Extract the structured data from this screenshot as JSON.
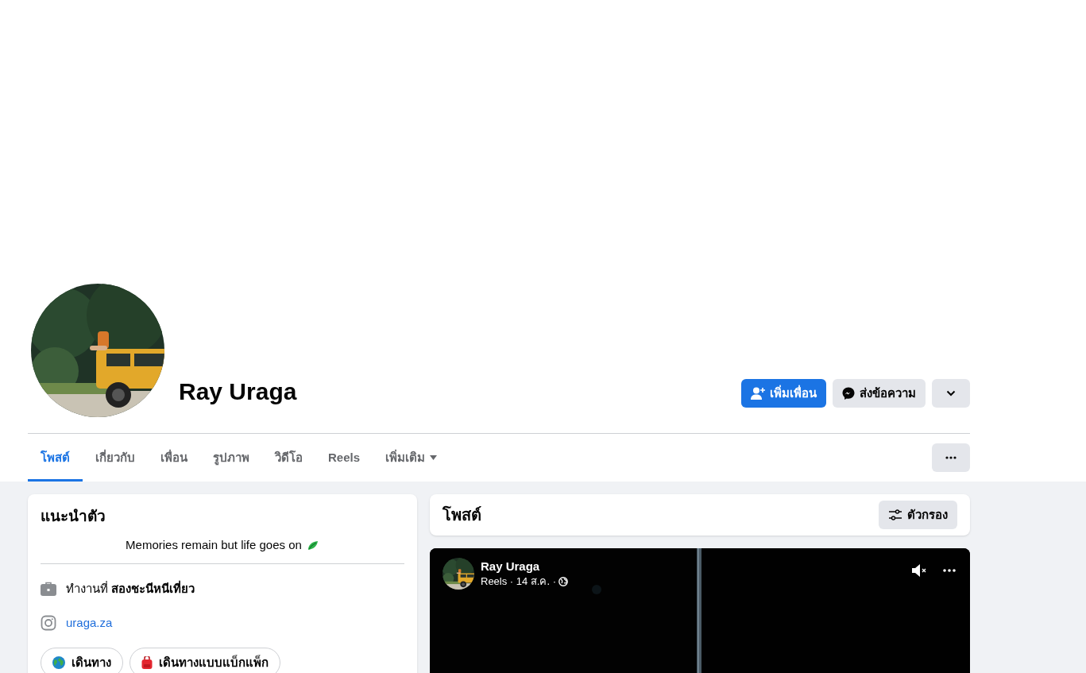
{
  "profile": {
    "name": "Ray Uraga"
  },
  "actions": [
    {
      "label": "เพิ่มเพื่อน",
      "kind": "primary"
    },
    {
      "label": "ส่งข้อความ",
      "kind": "message"
    },
    {
      "kind": "dropdown"
    }
  ],
  "tabs": [
    {
      "label": "โพสต์",
      "selected": true
    },
    {
      "label": "เกี่ยวกับ",
      "selected": false
    },
    {
      "label": "เพื่อน",
      "selected": false
    },
    {
      "label": "รูปภาพ",
      "selected": false
    },
    {
      "label": "วิดีโอ",
      "selected": false
    },
    {
      "label": "Reels",
      "selected": false
    },
    {
      "label": "เพิ่มเติม",
      "selected": false,
      "kind": "menu"
    }
  ],
  "intro": {
    "title": "แนะนำตัว",
    "bio": "Memories remain but life goes on",
    "details": [
      {
        "kind": "work",
        "text": "ทำงานที่ **สองชะนีหนีเที่ยว**"
      },
      {
        "kind": "instagram",
        "text": "uraga.za"
      }
    ],
    "hobbies": [
      {
        "label": "เดินทาง",
        "kind": "globe"
      },
      {
        "label": "เดินทางแบบแบ็กแพ็ก",
        "kind": "backpack"
      }
    ]
  },
  "posts_header": {
    "title": "โพสต์",
    "filter": "ตัวกรอง"
  },
  "post": {
    "author": "Ray Uraga",
    "meta": "Reels · 14 ส.ค. ·",
    "muted": true
  }
}
